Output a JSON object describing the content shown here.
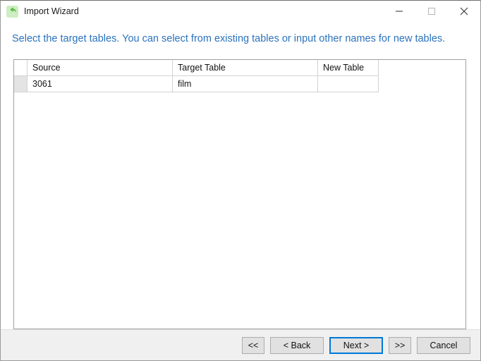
{
  "window": {
    "title": "Import Wizard",
    "icon": "import-arrow-icon",
    "controls": [
      {
        "name": "minimize",
        "glyph": "minimize-icon"
      },
      {
        "name": "maximize",
        "glyph": "maximize-icon"
      },
      {
        "name": "close",
        "glyph": "close-icon"
      }
    ]
  },
  "header": {
    "instruction": "Select the target tables. You can select from existing tables or input other names for new tables.",
    "color": "#2a72bd"
  },
  "grid": {
    "columns": [
      "Source",
      "Target Table",
      "New Table"
    ],
    "rows": [
      {
        "source": "3061",
        "target_table": "film",
        "new_table": ""
      }
    ]
  },
  "footer": {
    "buttons": [
      {
        "label": "<<",
        "name": "first-button",
        "default": false
      },
      {
        "label": "< Back",
        "name": "back-button",
        "default": false
      },
      {
        "label": "Next >",
        "name": "next-button",
        "default": true
      },
      {
        "label": ">>",
        "name": "last-button",
        "default": false
      },
      {
        "label": "Cancel",
        "name": "cancel-button",
        "default": false
      }
    ],
    "accent": "#0078d7"
  }
}
